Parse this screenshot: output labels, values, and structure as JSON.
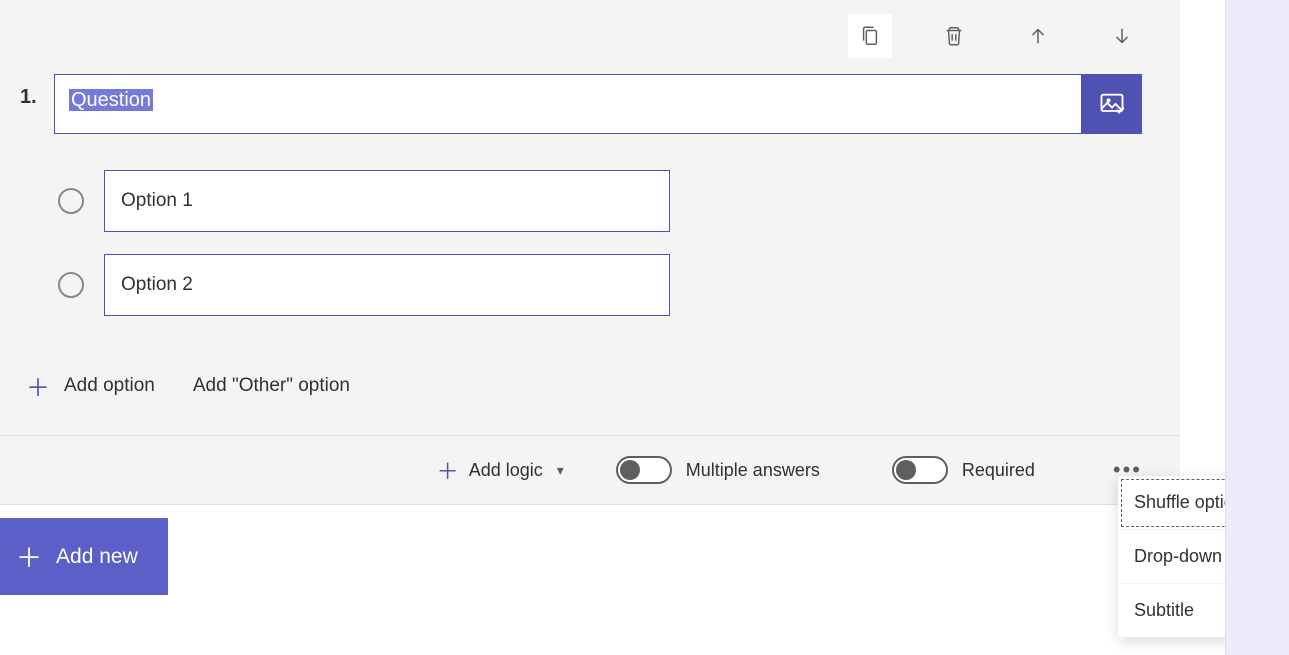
{
  "question": {
    "number": "1.",
    "text": "Question",
    "options": [
      "Option 1",
      "Option 2"
    ]
  },
  "actions": {
    "add_option": "Add option",
    "add_other": "Add \"Other\" option",
    "add_logic": "Add logic",
    "multiple_answers": "Multiple answers",
    "required": "Required",
    "add_new": "Add new"
  },
  "toggles": {
    "multiple_answers": false,
    "required": false
  },
  "dropdown": {
    "items": [
      "Shuffle options",
      "Drop-down",
      "Subtitle"
    ]
  },
  "colors": {
    "accent": "#4f52b2",
    "accent_light": "#5b5fc7"
  }
}
